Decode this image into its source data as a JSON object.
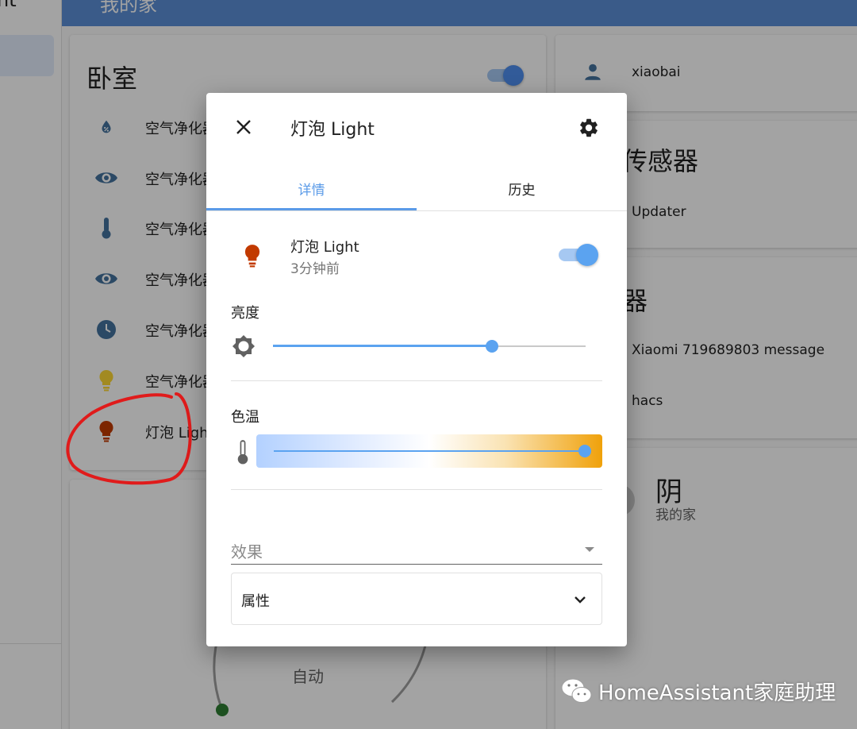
{
  "sidebar": {
    "title": "nt"
  },
  "topbar": {
    "title": "我的家"
  },
  "bedroom_card": {
    "title": "卧室",
    "entities": [
      {
        "label": "空气净化器",
        "icon": "water-percent-icon",
        "color": "#44739e"
      },
      {
        "label": "空气净化器",
        "icon": "eye-icon",
        "color": "#44739e"
      },
      {
        "label": "空气净化器",
        "icon": "thermometer-icon",
        "color": "#44739e"
      },
      {
        "label": "空气净化器",
        "icon": "eye-icon",
        "color": "#44739e"
      },
      {
        "label": "空气净化器",
        "icon": "clock-icon",
        "color": "#44739e"
      },
      {
        "label": "空气净化器",
        "icon": "lightbulb-icon",
        "color": "#fdd835"
      },
      {
        "label": "灯泡 Light",
        "icon": "lightbulb-icon",
        "color": "#c23a00"
      }
    ]
  },
  "thermostat_card": {
    "mode_label": "自动"
  },
  "user_card": {
    "name": "xiaobai"
  },
  "sensor_card": {
    "title": "传感器",
    "row": "Updater"
  },
  "device_card": {
    "title": "器",
    "rows": [
      "Xiaomi 719689803 message",
      "hacs"
    ]
  },
  "weather_card": {
    "condition": "阴",
    "location": "我的家"
  },
  "dialog": {
    "title": "灯泡 Light",
    "tabs": [
      {
        "label": "详情"
      },
      {
        "label": "历史"
      }
    ],
    "entity": {
      "name": "灯泡 Light",
      "last_changed": "3分钟前",
      "state_on": true,
      "icon_color": "#c23a00"
    },
    "brightness": {
      "label": "亮度",
      "value": 0.7
    },
    "color_temp": {
      "label": "色温",
      "value": 1.0
    },
    "effect": {
      "placeholder": "效果"
    },
    "attributes": {
      "label": "属性"
    }
  },
  "watermark": {
    "text": "HomeAssistant家庭助理"
  },
  "colors": {
    "accent": "#5b9be8",
    "annotation": "#e01b1b",
    "entity_icon": "#44739e"
  }
}
